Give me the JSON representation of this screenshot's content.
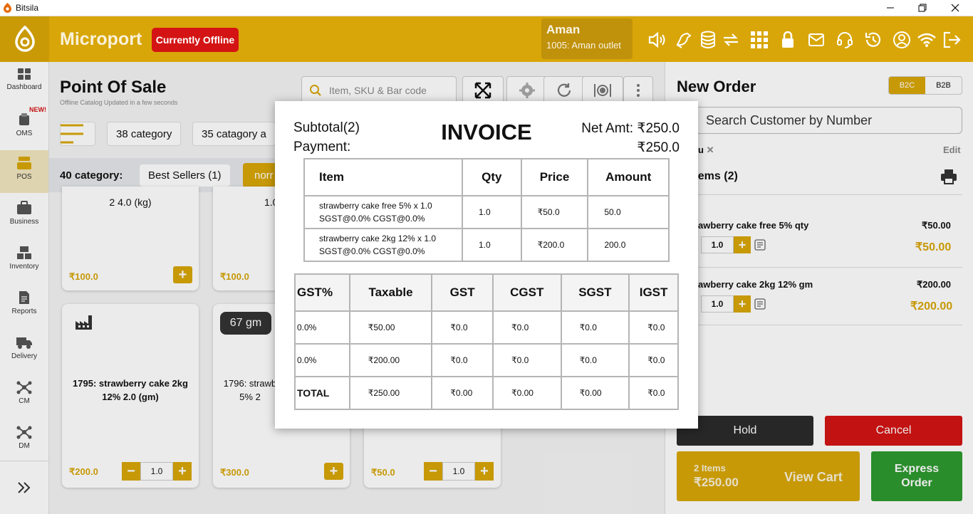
{
  "window": {
    "title": "Bitsila"
  },
  "header": {
    "brand": "Microport",
    "status": "Currently Offline",
    "user": {
      "name": "Aman",
      "outlet": "1005: Aman outlet"
    }
  },
  "sidebar": {
    "items": [
      {
        "label": "Dashboard"
      },
      {
        "label": "OMS"
      },
      {
        "label": "POS"
      },
      {
        "label": "Business"
      },
      {
        "label": "Inventory"
      },
      {
        "label": "Reports"
      },
      {
        "label": "Delivery"
      },
      {
        "label": "CM"
      },
      {
        "label": "DM"
      }
    ],
    "new_badge": "NEW!"
  },
  "main": {
    "title": "Point Of Sale",
    "subtitle": "Offline Catalog Updated in a few seconds",
    "search_placeholder": "Item, SKU & Bar code",
    "category_chips": [
      "38 category",
      "35 catagory a"
    ],
    "category_row_label": "40 category:",
    "category_tabs": [
      "Best Sellers (1)",
      "norr"
    ],
    "cards": [
      {
        "name_tail": "2 4.0 (kg)",
        "price": "₹100.0"
      },
      {
        "name_tail": "1.0",
        "price": "₹100.0"
      },
      {
        "name": "1795: strawberry cake 2kg 12% 2.0 (gm)",
        "price": "₹200.0",
        "qty": "1.0"
      },
      {
        "name": "1796: strawb 5% 2",
        "badge": "67 gm",
        "price": "₹300.0"
      },
      {
        "price": "₹50.0",
        "qty": "1.0"
      }
    ]
  },
  "order": {
    "title": "New Order",
    "tabs": [
      "B2C",
      "B2B"
    ],
    "customer_placeholder": "Search Customer by Number",
    "customer_chip": "u",
    "edit_label": "Edit",
    "items_header": "Items (2)",
    "items": [
      {
        "name": "awberry cake free 5%  qty",
        "unit_price": "₹50.00",
        "qty": "1.0",
        "total": "₹50.00"
      },
      {
        "name": "awberry cake 2kg 12%  gm",
        "unit_price": "₹200.00",
        "qty": "1.0",
        "total": "₹200.00"
      }
    ],
    "hold_label": "Hold",
    "cancel_label": "Cancel",
    "cart_count": "2 Items",
    "cart_total": "₹250.00",
    "view_cart_label": "View Cart",
    "express_label": "Express Order"
  },
  "invoice": {
    "title": "INVOICE",
    "subtotal": "Subtotal(2)",
    "payment": "Payment:",
    "net_amt": "Net Amt: ₹250.0",
    "payment_amt": "₹250.0",
    "items_columns": [
      "Item",
      "Qty",
      "Price",
      "Amount"
    ],
    "items": [
      {
        "line1": "strawberry cake free 5% x 1.0",
        "line2": "SGST@0.0% CGST@0.0%",
        "qty": "1.0",
        "price": "₹50.0",
        "amount": "50.0"
      },
      {
        "line1": "strawberry cake 2kg 12% x 1.0",
        "line2": "SGST@0.0% CGST@0.0%",
        "qty": "1.0",
        "price": "₹200.0",
        "amount": "200.0"
      }
    ],
    "tax_columns": [
      "GST%",
      "Taxable",
      "GST",
      "CGST",
      "SGST",
      "IGST"
    ],
    "tax_rows": [
      [
        "0.0%",
        "₹50.00",
        "₹0.0",
        "₹0.0",
        "₹0.0",
        "₹0.0"
      ],
      [
        "0.0%",
        "₹200.00",
        "₹0.0",
        "₹0.0",
        "₹0.0",
        "₹0.0"
      ],
      [
        "TOTAL",
        "₹250.00",
        "₹0.00",
        "₹0.00",
        "₹0.00",
        "₹0.0"
      ]
    ]
  },
  "colors": {
    "accent": "#d8a608",
    "danger": "#d41414",
    "success": "#239424"
  }
}
